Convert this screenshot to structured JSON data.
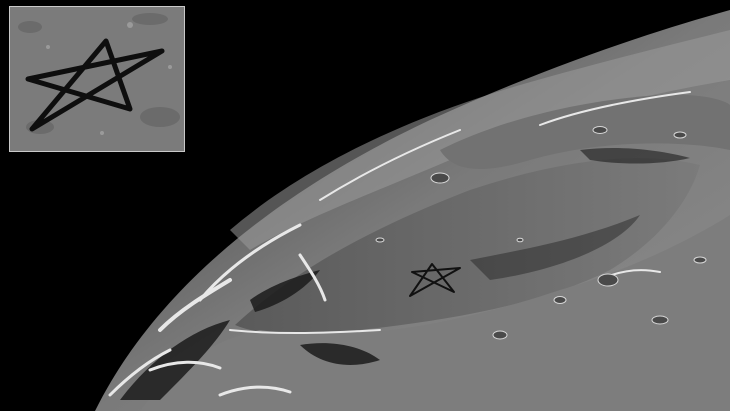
{
  "image": {
    "subject": "lunar-surface",
    "colors": {
      "space": "#000000",
      "mare": "#6f6f6f",
      "highlands": "#8a8a8a",
      "shadow": "#1a1a1a",
      "sunlit_rim": "#e6e6e6",
      "star_marking": "#111111",
      "inset_border": "#c9c9c9"
    },
    "icons": [
      "pentagram-marking"
    ]
  }
}
